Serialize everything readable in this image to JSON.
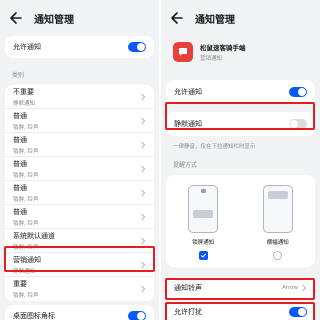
{
  "left": {
    "title": "通知管理",
    "allow": {
      "label": "允许通知",
      "on": true
    },
    "category_header": "类别",
    "items": [
      {
        "label": "不重要",
        "sub": "静默通知"
      },
      {
        "label": "普通",
        "sub": "锁屏, 铃声"
      },
      {
        "label": "普通",
        "sub": "锁屏, 铃声"
      },
      {
        "label": "普通",
        "sub": "锁屏, 铃声"
      },
      {
        "label": "普通",
        "sub": "锁屏, 铃声"
      },
      {
        "label": "普通",
        "sub": "锁屏, 铃声"
      },
      {
        "label": "系统默认通道",
        "sub": "锁屏, 铃声"
      },
      {
        "label": "营销通知",
        "sub": "静默通知"
      },
      {
        "label": "重要",
        "sub": "锁屏, 铃声"
      }
    ],
    "badge": {
      "label": "桌面图标角标"
    }
  },
  "right": {
    "title": "通知管理",
    "app": {
      "name": "松鼠速客骑手端",
      "sub": "营销通知",
      "icon": "speech-bubble-icon",
      "icon_color": "#e8403a"
    },
    "allow": {
      "label": "允许通知",
      "on": true
    },
    "silent": {
      "label": "静默通知",
      "on": false
    },
    "silent_desc": "一律静音，仅在下拉通知栏时显示",
    "method_header": "提醒方式",
    "methods": [
      {
        "label": "锁屏通知",
        "checked": true
      },
      {
        "label": "横幅通知",
        "checked": false
      }
    ],
    "ringtone": {
      "label": "通知铃声",
      "value": "Arrow"
    },
    "dnd": {
      "label": "允许打扰",
      "on": true
    }
  },
  "colors": {
    "accent": "#0a59f7",
    "highlight": "#e41e1e"
  }
}
